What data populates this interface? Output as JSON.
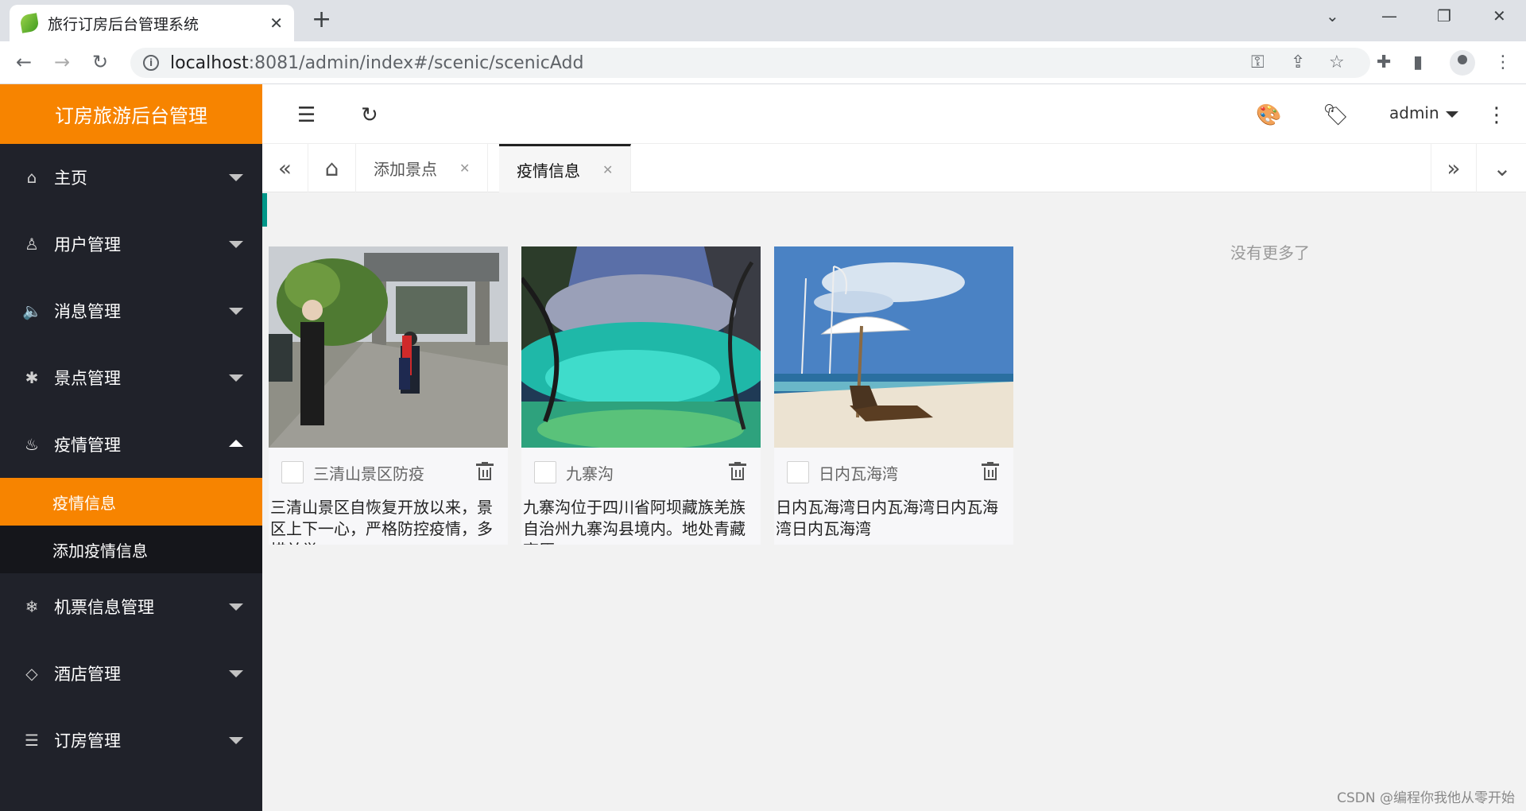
{
  "browser": {
    "tab_title": "旅行订房后台管理系统",
    "url_host": "localhost",
    "url_rest": ":8081/admin/index#/scenic/scenicAdd"
  },
  "app": {
    "logo": "订房旅游后台管理",
    "admin_label": "admin"
  },
  "sidebar": {
    "items": [
      {
        "label": "主页",
        "icon": "home-icon",
        "glyph": "⌂"
      },
      {
        "label": "用户管理",
        "icon": "user-icon",
        "glyph": "♙"
      },
      {
        "label": "消息管理",
        "icon": "speaker-icon",
        "glyph": "🔈"
      },
      {
        "label": "景点管理",
        "icon": "palm-icon",
        "glyph": "✱"
      },
      {
        "label": "疫情管理",
        "icon": "fire-icon",
        "glyph": "♨"
      },
      {
        "label": "机票信息管理",
        "icon": "snowflake-icon",
        "glyph": "❄"
      },
      {
        "label": "酒店管理",
        "icon": "diamond-icon",
        "glyph": "◇"
      },
      {
        "label": "订房管理",
        "icon": "list-icon",
        "glyph": "☰"
      }
    ],
    "sub_items": [
      {
        "label": "疫情信息"
      },
      {
        "label": "添加疫情信息"
      }
    ]
  },
  "page_tabs": [
    {
      "label": "添加景点"
    },
    {
      "label": "疫情信息"
    }
  ],
  "cards": [
    {
      "title": "三清山景区防疫",
      "desc": "三清山景区自恢复开放以来，景区上下一心，严格防控疫情，多措并举..."
    },
    {
      "title": "九寨沟",
      "desc": "九寨沟位于四川省阿坝藏族羌族自治州九寨沟县境内。地处青藏高原..."
    },
    {
      "title": "日内瓦海湾",
      "desc": "日内瓦海湾日内瓦海湾日内瓦海湾日内瓦海湾"
    }
  ],
  "no_more": "没有更多了",
  "watermark": "CSDN @编程你我他从零开始"
}
